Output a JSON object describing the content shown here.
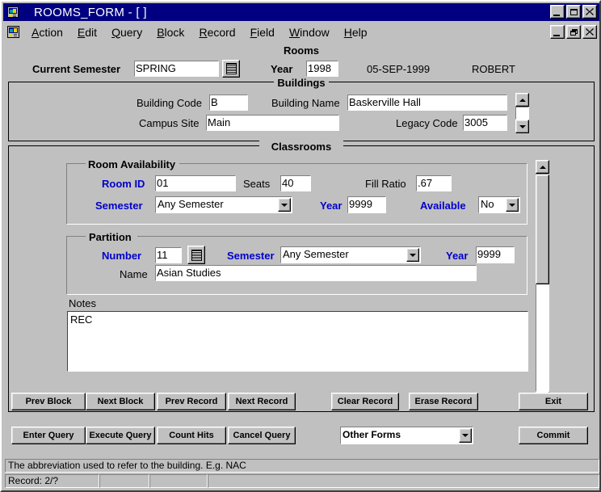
{
  "window": {
    "title": "ROOMS_FORM - [ ]",
    "app_icon": "forms-app-icon",
    "buttons": {
      "minimize": "minimize-button",
      "maximize": "maximize-button",
      "close": "close-button"
    }
  },
  "menubar": {
    "icon": "forms-doc-icon",
    "items": [
      {
        "label": "Action",
        "accel": "A"
      },
      {
        "label": "Edit",
        "accel": "E"
      },
      {
        "label": "Query",
        "accel": "Q"
      },
      {
        "label": "Block",
        "accel": "B"
      },
      {
        "label": "Record",
        "accel": "R"
      },
      {
        "label": "Field",
        "accel": "F"
      },
      {
        "label": "Window",
        "accel": "W"
      },
      {
        "label": "Help",
        "accel": "H"
      }
    ],
    "buttons": {
      "minimize": "minimize-button",
      "restore": "restore-button",
      "close": "close-button"
    }
  },
  "rooms": {
    "title": "Rooms",
    "current_semester_label": "Current Semester",
    "current_semester_value": "SPRING",
    "lov_icon": "list-of-values-icon",
    "year_label": "Year",
    "year_value": "1998",
    "date": "05-SEP-1999",
    "user": "ROBERT"
  },
  "buildings": {
    "title": "Buildings",
    "building_code_label": "Building Code",
    "building_code_value": "B",
    "building_name_label": "Building Name",
    "building_name_value": "Baskerville Hall",
    "campus_site_label": "Campus Site",
    "campus_site_value": "Main",
    "legacy_code_label": "Legacy Code",
    "legacy_code_value": "3005",
    "scroll_up_icon": "scroll-up-arrow-icon",
    "scroll_down_icon": "scroll-down-arrow-icon"
  },
  "classrooms": {
    "title": "Classrooms",
    "scroll_up_icon": "scroll-up-arrow-icon",
    "scroll_down_icon": "scroll-down-arrow-icon",
    "room_availability": {
      "title": "Room Availability",
      "room_id_label": "Room ID",
      "room_id_value": "01",
      "seats_label": "Seats",
      "seats_value": "40",
      "fill_ratio_label": "Fill Ratio",
      "fill_ratio_value": ".67",
      "semester_label": "Semester",
      "semester_value": "Any Semester",
      "year_label": "Year",
      "year_value": "9999",
      "available_label": "Available",
      "available_value": "No"
    },
    "partition": {
      "title": "Partition",
      "number_label": "Number",
      "number_value": "11",
      "lov_icon": "list-of-values-icon",
      "semester_label": "Semester",
      "semester_value": "Any Semester",
      "year_label": "Year",
      "year_value": "9999",
      "name_label": "Name",
      "name_value": "Asian Studies"
    },
    "notes": {
      "label": "Notes",
      "value": "REC"
    }
  },
  "toolbar": {
    "row1": [
      "Prev Block",
      "Next Block",
      "Prev Record",
      "Next Record",
      "Clear Record",
      "Erase Record",
      "Exit"
    ],
    "row2": [
      "Enter Query",
      "Execute Query",
      "Count Hits",
      "Cancel Query",
      "Commit"
    ],
    "other_forms_value": "Other Forms"
  },
  "status": {
    "message": "The abbreviation used to refer to the building. E.g. NAC",
    "record": "Record: 2/?",
    "cell2": "",
    "cell3": "",
    "cell4": ""
  }
}
